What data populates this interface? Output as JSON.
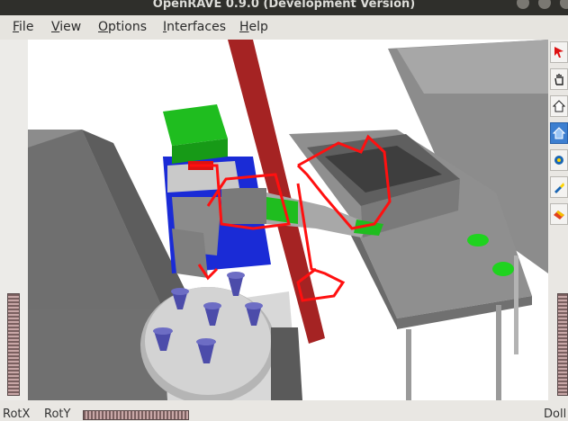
{
  "window": {
    "title": "OpenRAVE 0.9.0 (Development Version)"
  },
  "menu": {
    "items": [
      {
        "first": "F",
        "rest": "ile"
      },
      {
        "first": "V",
        "rest": "iew"
      },
      {
        "first": "O",
        "rest": "ptions"
      },
      {
        "first": "I",
        "rest": "nterfaces"
      },
      {
        "first": "H",
        "rest": "elp"
      }
    ]
  },
  "toolbar": {
    "tools": [
      {
        "icon": "select-arrow-icon"
      },
      {
        "icon": "hand-pan-icon"
      },
      {
        "icon": "home-icon"
      },
      {
        "icon": "view-all-icon",
        "active": true
      },
      {
        "icon": "camera-seek-icon"
      },
      {
        "icon": "flashlight-icon"
      },
      {
        "icon": "eraser-icon"
      }
    ]
  },
  "controls": {
    "rotx_label": "RotX",
    "roty_label": "RotY",
    "dolly_label": "Doll"
  },
  "colors": {
    "trajectory": "#ff1010",
    "pole": "#a52323",
    "robot_head": "#1fbd1f",
    "robot_body": "#1a2bd6",
    "cups": "#4c4caa"
  }
}
